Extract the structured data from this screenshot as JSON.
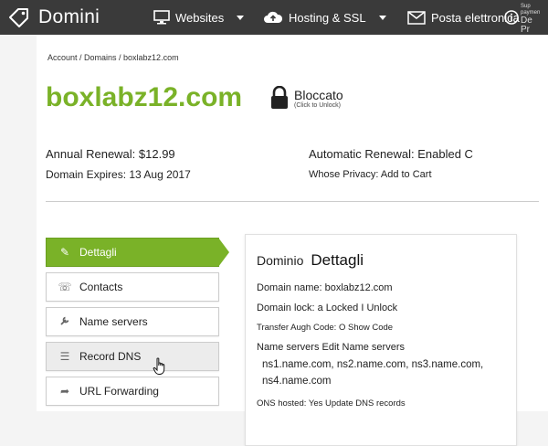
{
  "nav": {
    "brand": "Domini",
    "websites": "Websites",
    "hosting": "Hosting & SSL",
    "email": "Posta elettronica",
    "extra_line1": "Sup",
    "extra_line2": "paymen",
    "extra_line3": "De",
    "extra_line4": "Pr"
  },
  "breadcrumb": "Account / Domains / boxlabz12.com",
  "domain": {
    "name": "boxlabz12.com",
    "lock_status": "Bloccato",
    "lock_hint": "(Click to Unlock)"
  },
  "info": {
    "annual_renewal": "Annual Renewal: $12.99",
    "domain_expires": "Domain Expires: 13 Aug 2017",
    "auto_renewal": "Automatic Renewal: Enabled C",
    "whois_privacy": "Whose Privacy: Add to Cart"
  },
  "side_menu": [
    {
      "label": "Dettagli",
      "icon": "pencil-icon",
      "glyph": "✎"
    },
    {
      "label": "Contacts",
      "icon": "phone-icon",
      "glyph": "☏"
    },
    {
      "label": "Name servers",
      "icon": "wrench-icon",
      "glyph": "🔧"
    },
    {
      "label": "Record DNS",
      "icon": "list-icon",
      "glyph": "☰"
    },
    {
      "label": "URL Forwarding",
      "icon": "forward-arrow-icon",
      "glyph": "➦"
    }
  ],
  "card": {
    "heading_a": "Dominio",
    "heading_b": "Dettagli",
    "domain_name": "Domain name: boxlabz12.com",
    "domain_lock": "Domain lock: a Locked I Unlock",
    "transfer_auth": "Transfer Augh Code: O Show Code",
    "name_servers": "Name servers Edit Name servers",
    "ns_list": "ns1.name.com, ns2.name.com, ns3.name.com, ns4.name.com",
    "dns_hosted": "ONS hosted: Yes Update DNS records"
  },
  "colors": {
    "accent_green": "#7ab228",
    "nav_bg": "#3a3a3a"
  }
}
